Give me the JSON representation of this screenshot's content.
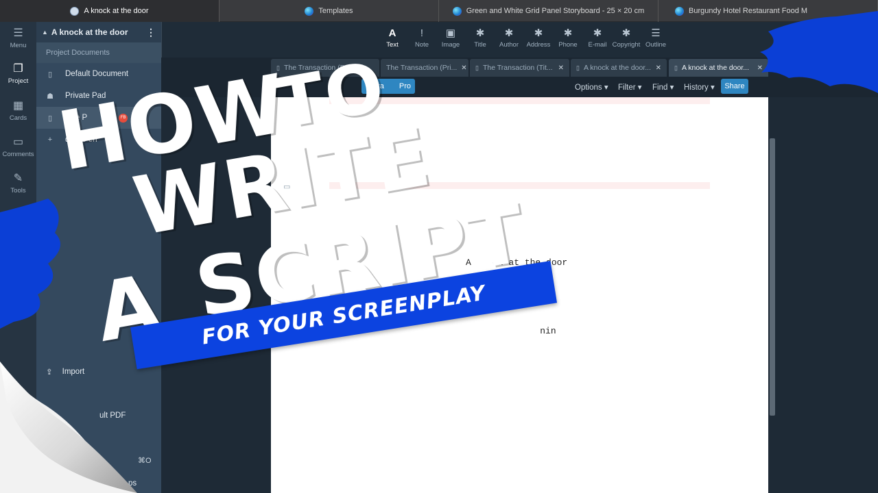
{
  "browser_tabs": [
    {
      "title": "A knock at the door",
      "icon": "writerduet-icon",
      "active": true
    },
    {
      "title": "Templates",
      "icon": "canva-icon",
      "active": false
    },
    {
      "title": "Green and White Grid Panel Storyboard - 25 × 20 cm",
      "icon": "canva-icon",
      "active": false
    },
    {
      "title": "Burgundy Hotel Restaurant Food M",
      "icon": "canva-icon",
      "active": false
    }
  ],
  "rail": {
    "menu": "Menu",
    "project": "Project",
    "cards": "Cards",
    "comments": "Comments",
    "tools": "Tools"
  },
  "panel": {
    "title": "A knock at the door",
    "section": "Project Documents",
    "items": [
      {
        "label": "Default Document",
        "icon": "document-icon"
      },
      {
        "label": "Private Pad",
        "icon": "incognito-icon"
      },
      {
        "label": "Title P",
        "icon": "document-icon",
        "badge": "FB"
      },
      {
        "label": "dd Do   en",
        "icon": "plus-icon"
      }
    ],
    "import": "Import",
    "pdf": "ult PDF",
    "shortcut": "⌘O",
    "bottom_fragment": "ps"
  },
  "toolbar": [
    {
      "label": "Text",
      "icon": "A"
    },
    {
      "label": "Note",
      "icon": "!"
    },
    {
      "label": "Image",
      "icon": "▣"
    },
    {
      "label": "Title",
      "icon": "✱"
    },
    {
      "label": "Author",
      "icon": "✱"
    },
    {
      "label": "Address",
      "icon": "✱"
    },
    {
      "label": "Phone",
      "icon": "✱"
    },
    {
      "label": "E-mail",
      "icon": "✱"
    },
    {
      "label": "Copyright",
      "icon": "✱"
    },
    {
      "label": "Outline",
      "icon": "☰"
    }
  ],
  "doc_tabs": [
    {
      "title": "The Transaction (De...",
      "active": false
    },
    {
      "title": "The Transaction (Pri...",
      "active": false
    },
    {
      "title": "The Transaction (Tit...",
      "active": false
    },
    {
      "title": "A knock at the door...",
      "active": false
    },
    {
      "title": "A knock at the door...",
      "active": true
    }
  ],
  "actions": {
    "pro_fragment": "ogra",
    "pro": "Pro",
    "options": "Options",
    "filter": "Filter",
    "find": "Find",
    "history": "History",
    "share": "Share"
  },
  "page": {
    "line1": "A    ck at the door",
    "line2": "         y",
    "line3": "         nin"
  },
  "overlay": {
    "line_how": "HOW",
    "line_to": "TO",
    "line_write": "WRITE",
    "line_a": "A",
    "line_script": "SCRIPT",
    "banner": "FOR YOUR SCREENPLAY",
    "brand_color": "#0c43e0"
  }
}
